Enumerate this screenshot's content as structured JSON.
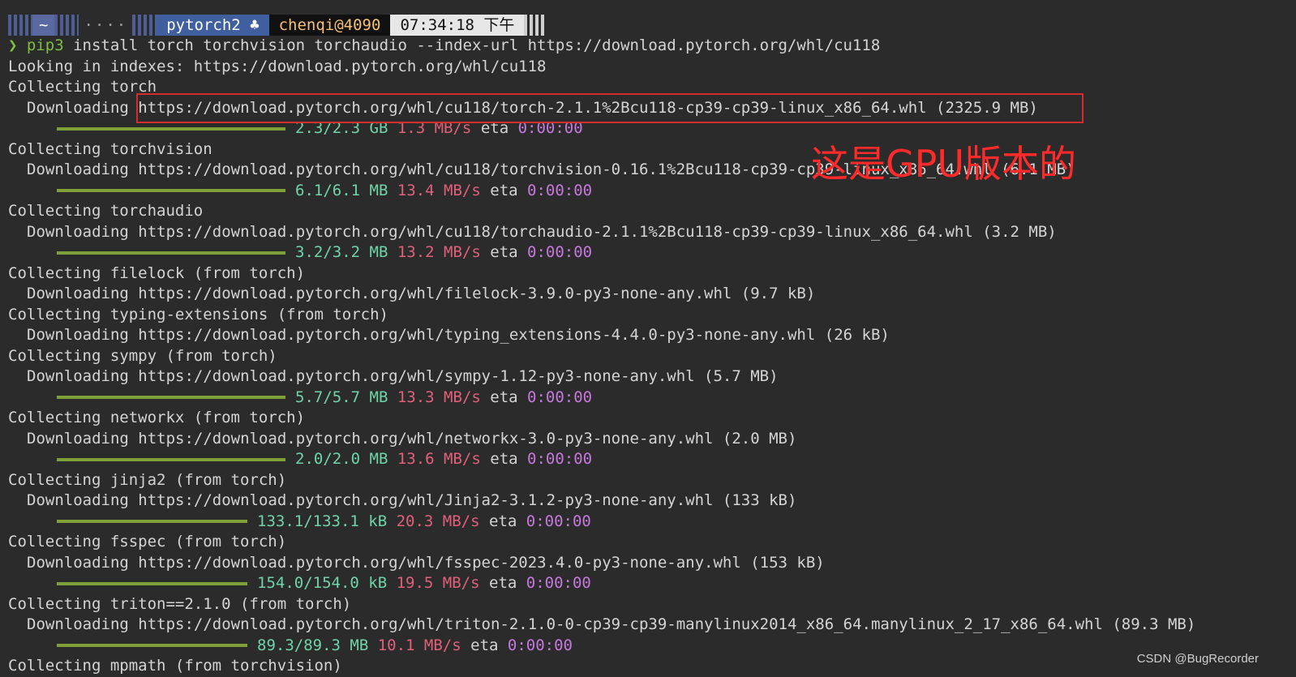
{
  "prompt": {
    "home": "~",
    "dots": "····",
    "env": "pytorch2 ♣",
    "user": "chenqi@4090",
    "time": "07:34:18 下午",
    "arrow": "❯"
  },
  "command": {
    "pip": "pip3",
    "rest": " install torch torchvision torchaudio --index-url https://download.pytorch.org/whl/cu118"
  },
  "lines": [
    {
      "type": "text",
      "text": "Looking in indexes: https://download.pytorch.org/whl/cu118"
    },
    {
      "type": "text",
      "text": "Collecting torch"
    },
    {
      "type": "indent",
      "text": "Downloading https://download.pytorch.org/whl/cu118/torch-2.1.1%2Bcu118-cp39-cp39-linux_x86_64.whl (2325.9 MB)"
    },
    {
      "type": "progress",
      "fraction": 1.0,
      "size": "2.3/2.3 GB",
      "speed": "1.3 MB/s",
      "eta_label": "eta",
      "eta": "0:00:00"
    },
    {
      "type": "text",
      "text": "Collecting torchvision"
    },
    {
      "type": "indent",
      "text": "Downloading https://download.pytorch.org/whl/cu118/torchvision-0.16.1%2Bcu118-cp39-cp39-linux_x86_64.whl (6.1 MB)"
    },
    {
      "type": "progress",
      "fraction": 1.0,
      "size": "6.1/6.1 MB",
      "speed": "13.4 MB/s",
      "eta_label": "eta",
      "eta": "0:00:00"
    },
    {
      "type": "text",
      "text": "Collecting torchaudio"
    },
    {
      "type": "indent",
      "text": "Downloading https://download.pytorch.org/whl/cu118/torchaudio-2.1.1%2Bcu118-cp39-cp39-linux_x86_64.whl (3.2 MB)"
    },
    {
      "type": "progress",
      "fraction": 1.0,
      "size": "3.2/3.2 MB",
      "speed": "13.2 MB/s",
      "eta_label": "eta",
      "eta": "0:00:00"
    },
    {
      "type": "text",
      "text": "Collecting filelock (from torch)"
    },
    {
      "type": "indent",
      "text": "Downloading https://download.pytorch.org/whl/filelock-3.9.0-py3-none-any.whl (9.7 kB)"
    },
    {
      "type": "text",
      "text": "Collecting typing-extensions (from torch)"
    },
    {
      "type": "indent",
      "text": "Downloading https://download.pytorch.org/whl/typing_extensions-4.4.0-py3-none-any.whl (26 kB)"
    },
    {
      "type": "text",
      "text": "Collecting sympy (from torch)"
    },
    {
      "type": "indent",
      "text": "Downloading https://download.pytorch.org/whl/sympy-1.12-py3-none-any.whl (5.7 MB)"
    },
    {
      "type": "progress",
      "fraction": 1.0,
      "size": "5.7/5.7 MB",
      "speed": "13.3 MB/s",
      "eta_label": "eta",
      "eta": "0:00:00"
    },
    {
      "type": "text",
      "text": "Collecting networkx (from torch)"
    },
    {
      "type": "indent",
      "text": "Downloading https://download.pytorch.org/whl/networkx-3.0-py3-none-any.whl (2.0 MB)"
    },
    {
      "type": "progress",
      "fraction": 1.0,
      "size": "2.0/2.0 MB",
      "speed": "13.6 MB/s",
      "eta_label": "eta",
      "eta": "0:00:00"
    },
    {
      "type": "text",
      "text": "Collecting jinja2 (from torch)"
    },
    {
      "type": "indent",
      "text": "Downloading https://download.pytorch.org/whl/Jinja2-3.1.2-py3-none-any.whl (133 kB)"
    },
    {
      "type": "progress",
      "fraction": 1.0,
      "size": "133.1/133.1 kB",
      "speed": "20.3 MB/s",
      "eta_label": "eta",
      "eta": "0:00:00"
    },
    {
      "type": "text",
      "text": "Collecting fsspec (from torch)"
    },
    {
      "type": "indent",
      "text": "Downloading https://download.pytorch.org/whl/fsspec-2023.4.0-py3-none-any.whl (153 kB)"
    },
    {
      "type": "progress",
      "fraction": 1.0,
      "size": "154.0/154.0 kB",
      "speed": "19.5 MB/s",
      "eta_label": "eta",
      "eta": "0:00:00"
    },
    {
      "type": "text",
      "text": "Collecting triton==2.1.0 (from torch)"
    },
    {
      "type": "indent",
      "text": "Downloading https://download.pytorch.org/whl/triton-2.1.0-0-cp39-cp39-manylinux2014_x86_64.manylinux_2_17_x86_64.whl (89.3 MB)"
    },
    {
      "type": "progress",
      "fraction": 1.0,
      "size": "89.3/89.3 MB",
      "speed": "10.1 MB/s",
      "eta_label": "eta",
      "eta": "0:00:00"
    },
    {
      "type": "text",
      "text": "Collecting mpmath (from torchvision)"
    }
  ],
  "annotation": "这是GPU版本的",
  "watermark": "CSDN @BugRecorder",
  "colors": {
    "background": "#2b2b2b",
    "progress_bar": "#7fa038",
    "size": "#6fd3a8",
    "speed": "#e0607a",
    "eta_time": "#c678dd",
    "highlight": "#d22c2c"
  }
}
